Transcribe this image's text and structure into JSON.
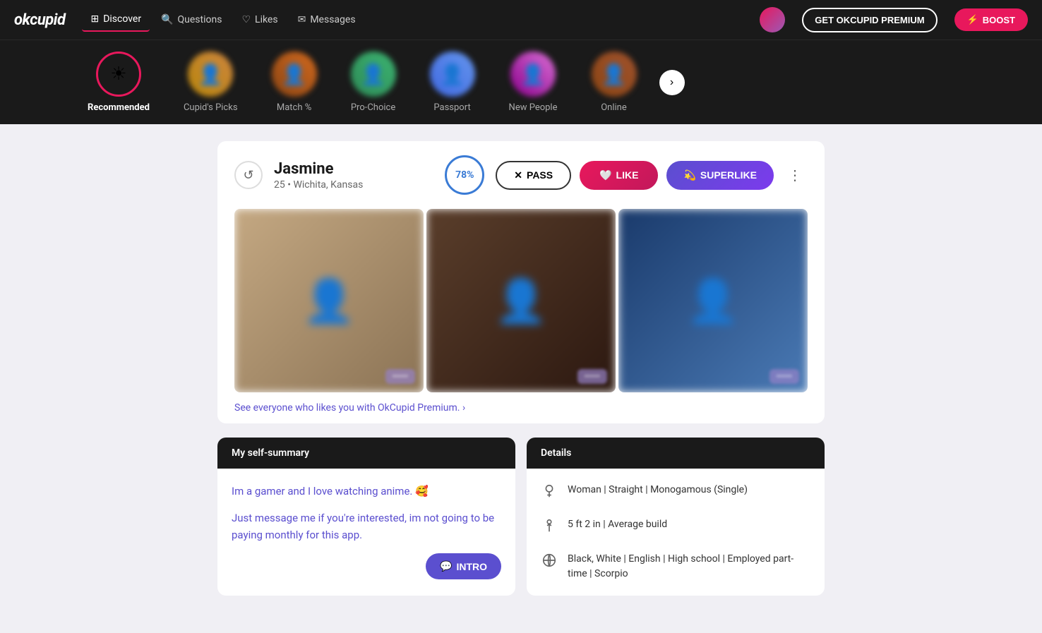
{
  "app": {
    "logo": "okcupid",
    "premium_btn": "GET OKCUPID PREMIUM",
    "boost_btn": "⚡ BOOST"
  },
  "navbar": {
    "links": [
      {
        "id": "discover",
        "label": "Discover",
        "icon": "🔲",
        "active": true
      },
      {
        "id": "questions",
        "label": "Questions",
        "icon": "💬"
      },
      {
        "id": "likes",
        "label": "Likes",
        "icon": "♡"
      },
      {
        "id": "messages",
        "label": "Messages",
        "icon": "✉"
      }
    ]
  },
  "categories": [
    {
      "id": "recommended",
      "label": "Recommended",
      "active": true,
      "icon": "sparkle"
    },
    {
      "id": "cupids-picks",
      "label": "Cupid's Picks"
    },
    {
      "id": "match",
      "label": "Match %"
    },
    {
      "id": "pro-choice",
      "label": "Pro-Choice"
    },
    {
      "id": "passport",
      "label": "Passport"
    },
    {
      "id": "new-people",
      "label": "New People"
    },
    {
      "id": "online",
      "label": "Online"
    }
  ],
  "profile": {
    "name": "Jasmine",
    "age": "25",
    "location": "Wichita, Kansas",
    "match_percent": "78%",
    "actions": {
      "pass": "PASS",
      "like": "LIKE",
      "superlike": "SUPERLIKE"
    },
    "premium_prompt": "See everyone who likes you with OkCupid Premium. ›"
  },
  "self_summary": {
    "header": "My self-summary",
    "text1": "Im a gamer and I love watching anime. 🥰",
    "text2": "Just message me if you're interested, im not going to be paying monthly for this app.",
    "intro_btn": "INTRO"
  },
  "details": {
    "header": "Details",
    "items": [
      {
        "icon": "gender",
        "text": "Woman | Straight | Monogamous (Single)"
      },
      {
        "icon": "height",
        "text": "5 ft 2 in | Average build"
      },
      {
        "icon": "globe",
        "text": "Black, White | English | High school | Employed part-time | Scorpio"
      }
    ]
  }
}
